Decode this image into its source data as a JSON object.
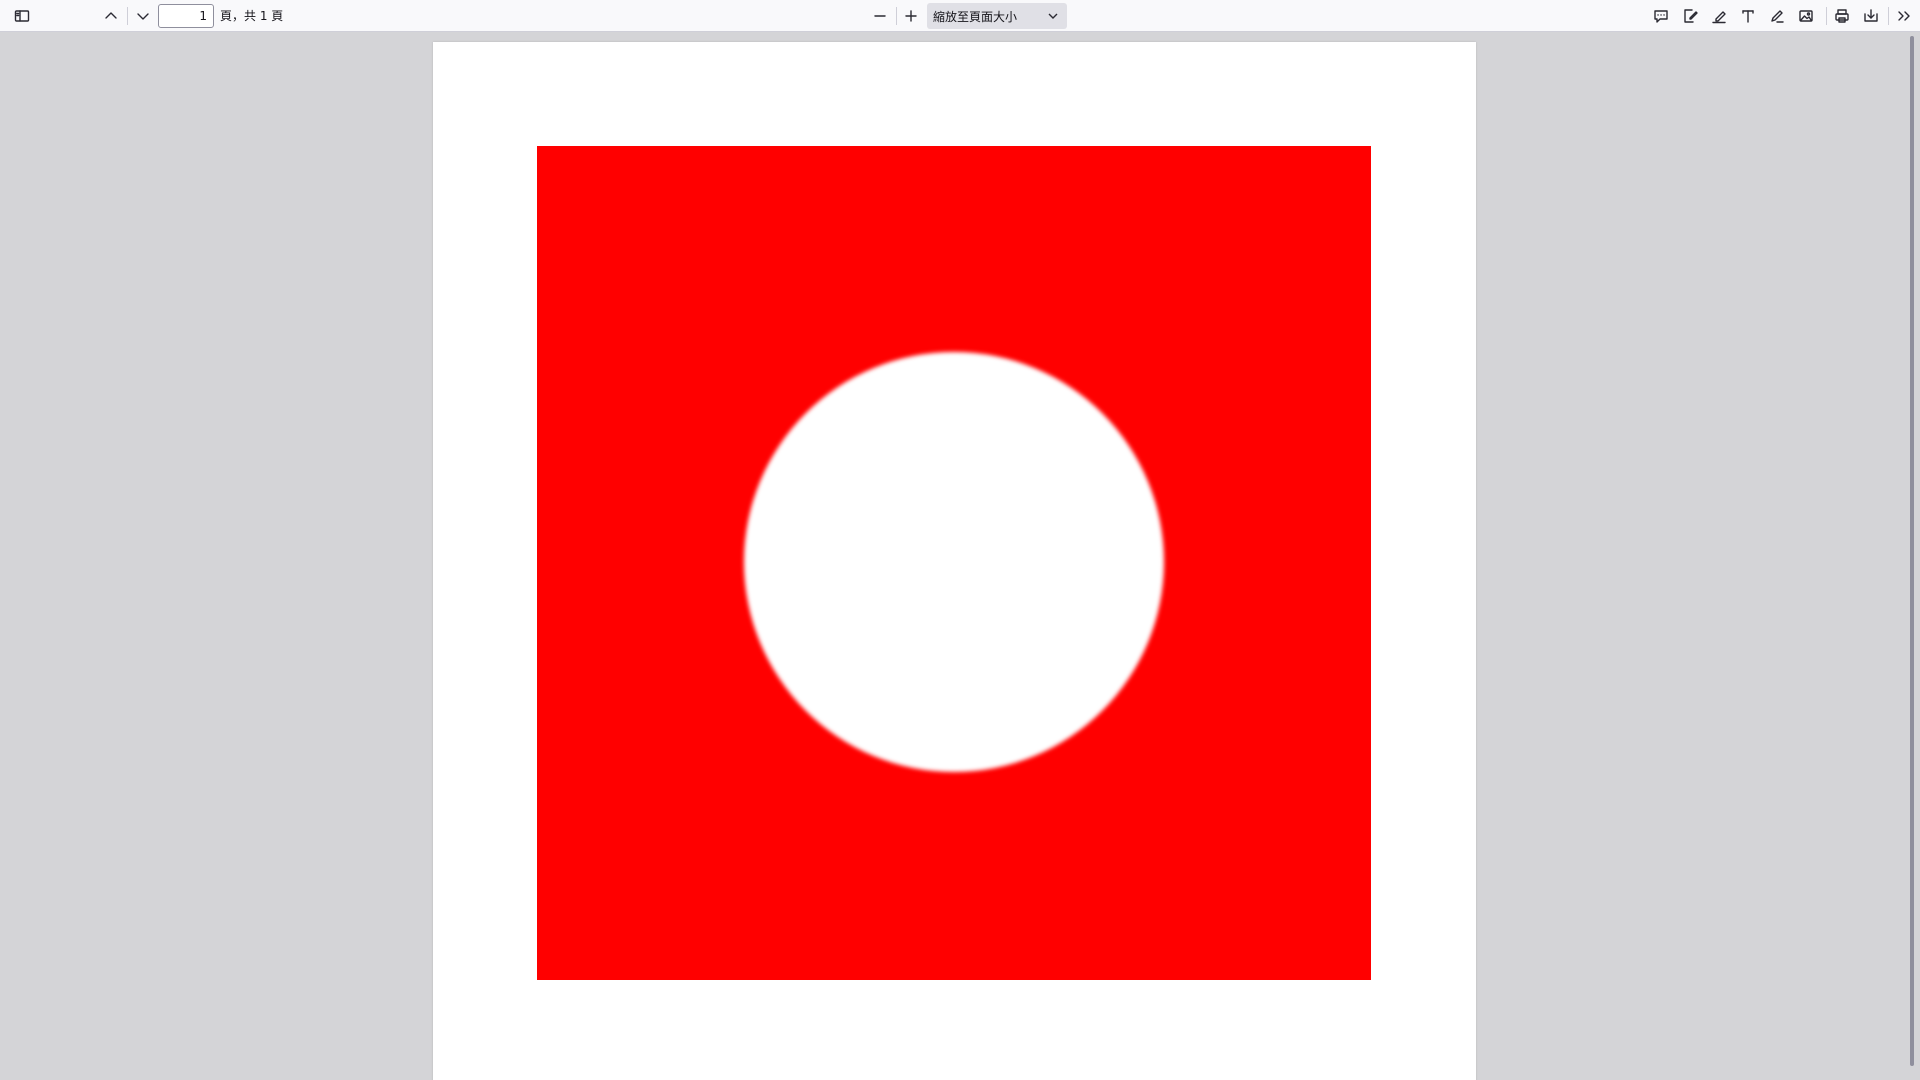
{
  "toolbar": {
    "sidebar_toggle_icon": "sidebar-toggle-icon",
    "prev_page_icon": "chevron-up-icon",
    "next_page_icon": "chevron-down-icon",
    "page_number": "1",
    "page_count_text": "頁，共 1 頁",
    "zoom_out_icon": "minus-icon",
    "zoom_in_icon": "plus-icon",
    "zoom_value": "縮放至頁面大小",
    "right_tools": [
      "comment-icon",
      "signature-icon",
      "highlight-icon",
      "text-icon",
      "draw-icon",
      "image-icon",
      "print-icon",
      "save-icon",
      "more-tools-icon"
    ]
  },
  "document": {
    "page_background": "#ffffff",
    "square_color": "#ff0000",
    "circle_color": "#ffffff"
  },
  "colors": {
    "viewer_background": "#d4d4d7",
    "toolbar_background": "#f9f9fb"
  }
}
